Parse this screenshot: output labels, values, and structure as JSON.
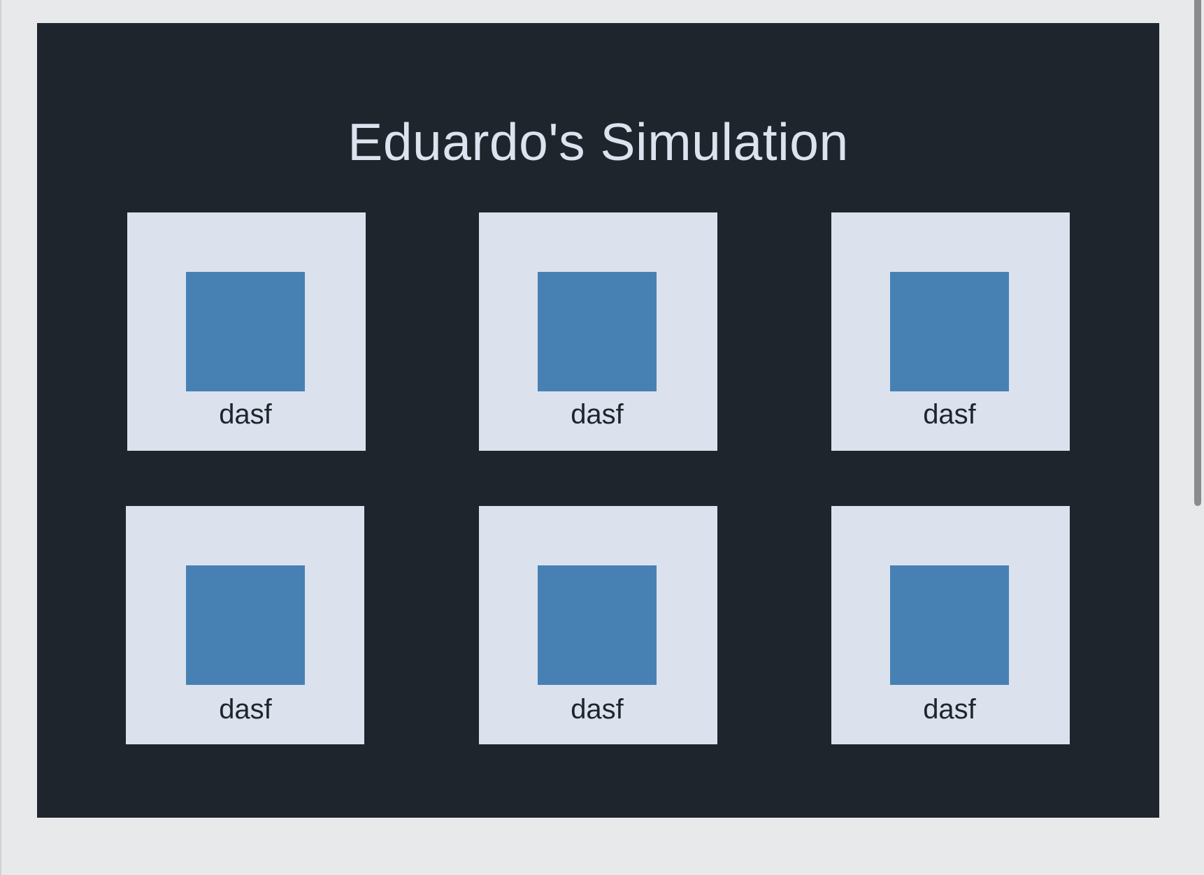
{
  "page": {
    "title": "Eduardo's Simulation"
  },
  "colors": {
    "page_background": "#e8e9eb",
    "panel_background": "#1e252d",
    "title_text": "#dde3ee",
    "card_background": "#dce2ed",
    "square_fill": "#4781b4",
    "label_text": "#1e252d",
    "scrollbar_thumb": "#8b8b8b"
  },
  "cards": [
    {
      "label": "dasf"
    },
    {
      "label": "dasf"
    },
    {
      "label": "dasf"
    },
    {
      "label": "dasf"
    },
    {
      "label": "dasf"
    },
    {
      "label": "dasf"
    }
  ]
}
